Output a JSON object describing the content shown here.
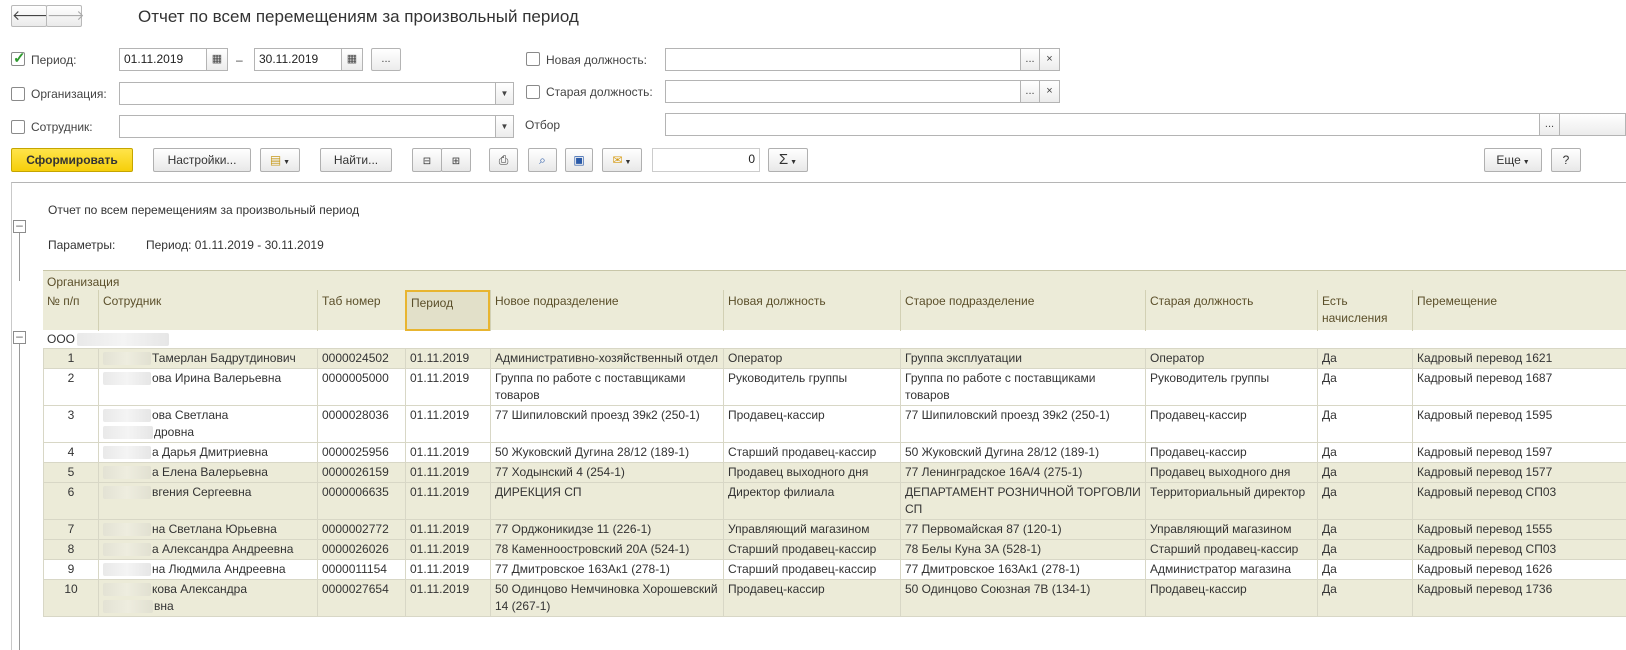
{
  "window": {
    "title": "Отчет по всем перемещениям за произвольный период"
  },
  "nav": {
    "back_icon": "arrow-left-icon",
    "forward_icon": "arrow-right-icon"
  },
  "filters": {
    "period_label": "Период:",
    "period_checked": true,
    "date_from": "01.11.2019",
    "date_to": "30.11.2019",
    "dash": "–",
    "more_label": "...",
    "org_label": "Организация:",
    "employee_label": "Сотрудник:",
    "new_pos_label": "Новая должность:",
    "old_pos_label": "Старая должность:",
    "filter_label": "Отбор",
    "clear_label": "×"
  },
  "toolbar": {
    "form_label": "Сформировать",
    "settings_label": "Настройки...",
    "find_label": "Найти...",
    "sum_value": "0",
    "sum_symbol": "Σ",
    "more_label": "Еще",
    "help_label": "?"
  },
  "report": {
    "title": "Отчет по всем перемещениям за произвольный период",
    "params_label": "Параметры:",
    "params_value": "Период: 01.11.2019 - 30.11.2019",
    "org_header": "Организация",
    "columns": [
      "№ п/п",
      "Сотрудник",
      "Таб номер",
      "Период",
      "Новое подразделение",
      "Новая должность",
      "Старое подразделение",
      "Старая должность",
      "Есть начисления",
      "Перемещение"
    ],
    "group_label": "ООО",
    "rows": [
      {
        "n": "1",
        "employee": "Тамерлан Бадрутдинович",
        "tab": "0000024502",
        "period": "01.11.2019",
        "new_dep": "Административно-хозяйственный отдел",
        "new_pos": "Оператор",
        "old_dep": "Группа эксплуатации",
        "old_pos": "Оператор",
        "accr": "Да",
        "move": "Кадровый перевод 1621",
        "shaded": true
      },
      {
        "n": "2",
        "employee": "ова Ирина Валерьевна",
        "tab": "0000005000",
        "period": "01.11.2019",
        "new_dep": "Группа по работе с поставщиками товаров",
        "new_pos": "Руководитель группы",
        "old_dep": "Группа по работе с поставщиками товаров",
        "old_pos": "Руководитель группы",
        "accr": "Да",
        "move": "Кадровый перевод 1687",
        "shaded": false
      },
      {
        "n": "3",
        "employee": "ова Светлана\nдровна",
        "tab": "0000028036",
        "period": "01.11.2019",
        "new_dep": "77 Шипиловский проезд 39к2 (250-1)",
        "new_pos": "Продавец-кассир",
        "old_dep": "77 Шипиловский проезд 39к2 (250-1)",
        "old_pos": "Продавец-кассир",
        "accr": "Да",
        "move": "Кадровый перевод 1595",
        "shaded": false
      },
      {
        "n": "4",
        "employee": "а Дарья Дмитриевна",
        "tab": "0000025956",
        "period": "01.11.2019",
        "new_dep": "50 Жуковский Дугина 28/12 (189-1)",
        "new_pos": "Старший продавец-кассир",
        "old_dep": "50 Жуковский Дугина 28/12 (189-1)",
        "old_pos": "Продавец-кассир",
        "accr": "Да",
        "move": "Кадровый перевод 1597",
        "shaded": false
      },
      {
        "n": "5",
        "employee": "а Елена Валерьевна",
        "tab": "0000026159",
        "period": "01.11.2019",
        "new_dep": "77 Ходынский 4 (254-1)",
        "new_pos": "Продавец выходного дня",
        "old_dep": "77 Ленинградское 16А/4 (275-1)",
        "old_pos": "Продавец выходного дня",
        "accr": "Да",
        "move": "Кадровый перевод 1577",
        "shaded": true
      },
      {
        "n": "6",
        "employee": "вгения Сергеевна",
        "tab": "0000006635",
        "period": "01.11.2019",
        "new_dep": "ДИРЕКЦИЯ СП",
        "new_pos": "Директор филиала",
        "old_dep": "ДЕПАРТАМЕНТ РОЗНИЧНОЙ ТОРГОВЛИ СП",
        "old_pos": "Территориальный директор",
        "accr": "Да",
        "move": "Кадровый перевод СП03",
        "shaded": true
      },
      {
        "n": "7",
        "employee": "на Светлана Юрьевна",
        "tab": "0000002772",
        "period": "01.11.2019",
        "new_dep": "77 Орджоникидзе 11 (226-1)",
        "new_pos": "Управляющий магазином",
        "old_dep": "77 Первомайская 87 (120-1)",
        "old_pos": "Управляющий магазином",
        "accr": "Да",
        "move": "Кадровый перевод 1555",
        "shaded": true
      },
      {
        "n": "8",
        "employee": "а Александра Андреевна",
        "tab": "0000026026",
        "period": "01.11.2019",
        "new_dep": "78 Каменноостровский 20А (524-1)",
        "new_pos": "Старший продавец-кассир",
        "old_dep": "78 Белы Куна 3А (528-1)",
        "old_pos": "Старший продавец-кассир",
        "accr": "Да",
        "move": "Кадровый перевод СП03",
        "shaded": true
      },
      {
        "n": "9",
        "employee": "на Людмила Андреевна",
        "tab": "0000011154",
        "period": "01.11.2019",
        "new_dep": "77 Дмитровское 163Ак1 (278-1)",
        "new_pos": "Старший продавец-кассир",
        "old_dep": "77 Дмитровское 163Ак1 (278-1)",
        "old_pos": "Администратор магазина",
        "accr": "Да",
        "move": "Кадровый перевод 1626",
        "shaded": false
      },
      {
        "n": "10",
        "employee": "кова Александра\nвна",
        "tab": "0000027654",
        "period": "01.11.2019",
        "new_dep": "50 Одинцово Немчиновка Хорошевский 14 (267-1)",
        "new_pos": "Продавец-кассир",
        "old_dep": "50 Одинцово Союзная 7В (134-1)",
        "old_pos": "Продавец-кассир",
        "accr": "Да",
        "move": "Кадровый перевод 1736",
        "shaded": true
      }
    ]
  }
}
